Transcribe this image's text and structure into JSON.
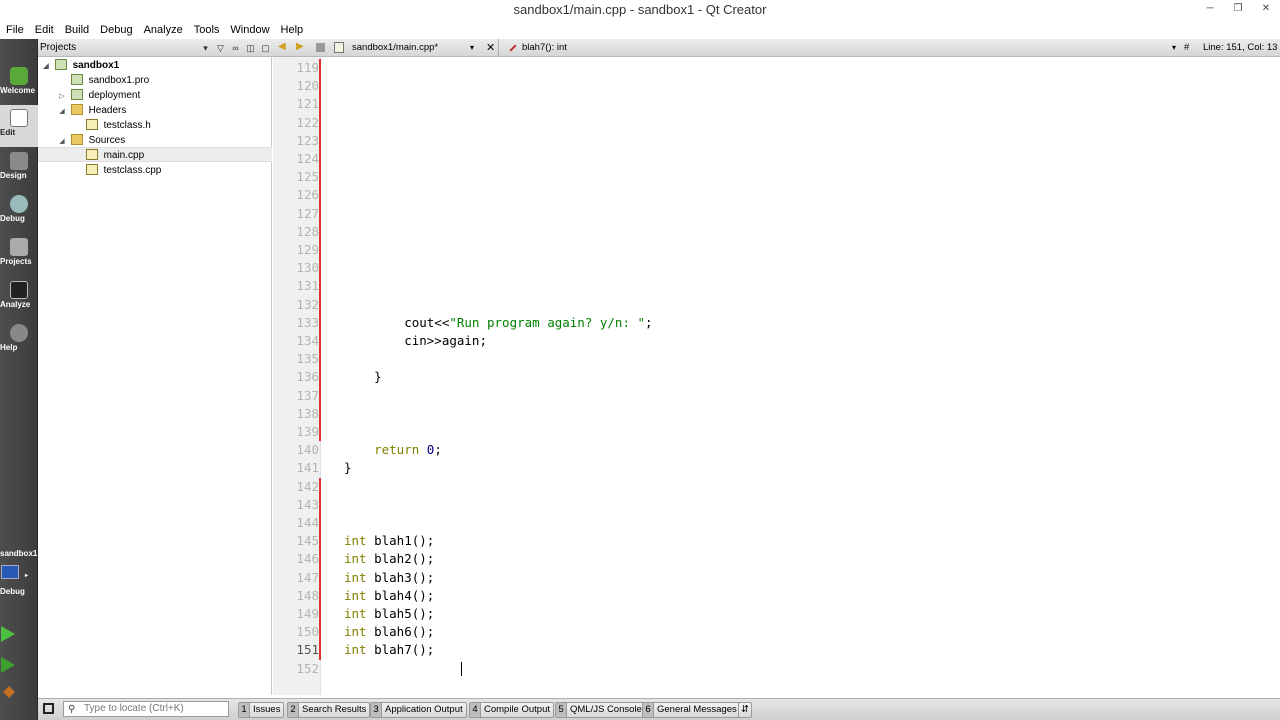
{
  "window": {
    "title": "sandbox1/main.cpp - sandbox1 - Qt Creator",
    "buttons": [
      "minimize",
      "restore",
      "close"
    ]
  },
  "menubar": {
    "items": [
      "File",
      "Edit",
      "Build",
      "Debug",
      "Analyze",
      "Tools",
      "Window",
      "Help"
    ]
  },
  "modes": [
    {
      "label": "Welcome",
      "icon": "qt-logo-icon",
      "active": false
    },
    {
      "label": "Edit",
      "icon": "edit-document-icon",
      "active": true
    },
    {
      "label": "Design",
      "icon": "design-pencil-icon",
      "active": false
    },
    {
      "label": "Debug",
      "icon": "debug-bug-icon",
      "active": false
    },
    {
      "label": "Projects",
      "icon": "projects-wrench-icon",
      "active": false
    },
    {
      "label": "Analyze",
      "icon": "analyze-monitor-icon",
      "active": false
    },
    {
      "label": "Help",
      "icon": "help-question-icon",
      "active": false
    }
  ],
  "target": {
    "project": "sandbox1",
    "build": "Debug"
  },
  "navigator": {
    "title": "Projects",
    "tree": [
      {
        "label": "sandbox1",
        "level": 0,
        "expanded": true,
        "icon": "project-icon"
      },
      {
        "label": "sandbox1.pro",
        "level": 1,
        "icon": "pro-file-icon"
      },
      {
        "label": "deployment",
        "level": 1,
        "expanded": false,
        "icon": "folder-icon"
      },
      {
        "label": "Headers",
        "level": 1,
        "expanded": true,
        "icon": "folder-icon"
      },
      {
        "label": "testclass.h",
        "level": 2,
        "icon": "header-file-icon"
      },
      {
        "label": "Sources",
        "level": 1,
        "expanded": true,
        "icon": "folder-icon"
      },
      {
        "label": "main.cpp",
        "level": 2,
        "icon": "source-file-icon",
        "selected": true
      },
      {
        "label": "testclass.cpp",
        "level": 2,
        "icon": "source-file-icon"
      }
    ]
  },
  "editor": {
    "document": "sandbox1/main.cpp*",
    "symbol": "blah7(): int",
    "position": "Line: 151, Col: 13",
    "current_line": 151,
    "lines": [
      {
        "n": 119,
        "text": ""
      },
      {
        "n": 120,
        "text": ""
      },
      {
        "n": 121,
        "text": ""
      },
      {
        "n": 122,
        "text": ""
      },
      {
        "n": 123,
        "text": ""
      },
      {
        "n": 124,
        "text": ""
      },
      {
        "n": 125,
        "text": ""
      },
      {
        "n": 126,
        "text": ""
      },
      {
        "n": 127,
        "text": ""
      },
      {
        "n": 128,
        "text": ""
      },
      {
        "n": 129,
        "text": ""
      },
      {
        "n": 130,
        "text": ""
      },
      {
        "n": 131,
        "text": ""
      },
      {
        "n": 132,
        "text": ""
      },
      {
        "n": 133,
        "text": "        cout<<\"Run program again? y/n: \";"
      },
      {
        "n": 134,
        "text": "        cin>>again;"
      },
      {
        "n": 135,
        "text": ""
      },
      {
        "n": 136,
        "text": "    }"
      },
      {
        "n": 137,
        "text": ""
      },
      {
        "n": 138,
        "text": ""
      },
      {
        "n": 139,
        "text": ""
      },
      {
        "n": 140,
        "text": "    return 0;"
      },
      {
        "n": 141,
        "text": "}"
      },
      {
        "n": 142,
        "text": ""
      },
      {
        "n": 143,
        "text": ""
      },
      {
        "n": 144,
        "text": ""
      },
      {
        "n": 145,
        "text": "int blah1();"
      },
      {
        "n": 146,
        "text": "int blah2();"
      },
      {
        "n": 147,
        "text": "int blah3();"
      },
      {
        "n": 148,
        "text": "int blah4();"
      },
      {
        "n": 149,
        "text": "int blah5();"
      },
      {
        "n": 150,
        "text": "int blah6();"
      },
      {
        "n": 151,
        "text": "int blah7();"
      },
      {
        "n": 152,
        "text": ""
      }
    ],
    "modified_lines": [
      [
        119,
        139
      ],
      [
        142,
        151
      ]
    ]
  },
  "statusbar": {
    "locator_placeholder": "Type to locate (Ctrl+K)",
    "panes": [
      {
        "num": "1",
        "label": "Issues"
      },
      {
        "num": "2",
        "label": "Search Results"
      },
      {
        "num": "3",
        "label": "Application Output"
      },
      {
        "num": "4",
        "label": "Compile Output"
      },
      {
        "num": "5",
        "label": "QML/JS Console"
      },
      {
        "num": "6",
        "label": "General Messages"
      }
    ]
  },
  "colors": {
    "keyword": "#808000",
    "string": "#008000",
    "number": "#000080",
    "change_marker": "#e03030",
    "mode_bar": "#444444"
  }
}
